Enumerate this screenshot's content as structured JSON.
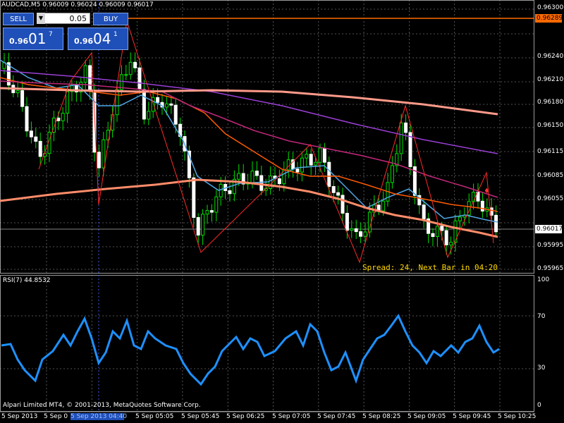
{
  "header": {
    "title": "AUDCAD,M5",
    "ohlc": "0.96009 0.96024 0.96009 0.96017"
  },
  "trade_panel": {
    "sell_label": "SELL",
    "buy_label": "BUY",
    "lot_value": "0.05",
    "sell_small": "0.96",
    "sell_big": "01",
    "sell_sup": "7",
    "buy_small": "0.96",
    "buy_big": "04",
    "buy_sup": "1"
  },
  "price_axis": {
    "labels": [
      "0.96300",
      "0.96240",
      "0.96210",
      "0.96180",
      "0.96150",
      "0.96115",
      "0.96085",
      "0.96055",
      "0.95995",
      "0.95965"
    ],
    "hline_tag": "0.96289",
    "bid_tag": "0.96017",
    "hline_color": "#ff6a00"
  },
  "status": {
    "spread_text": "Spread: 24, Next Bar in 04:20",
    "spread_color": "#ffd700"
  },
  "rsi": {
    "label": "RSI(7) 44.8532",
    "levels": [
      "100",
      "70",
      "30",
      "0"
    ],
    "color": "#1e90ff"
  },
  "footer": {
    "copyright": "Alpari Limited MT4, © 2001-2013, MetaQuotes Software Corp."
  },
  "time_axis": {
    "labels": [
      "5 Sep 2013",
      "5 Sep 0",
      "5 Sep 05:05",
      "5 Sep 05:45",
      "5 Sep 06:25",
      "5 Sep 07:05",
      "5 Sep 07:45",
      "5 Sep 08:25",
      "5 Sep 09:05",
      "5 Sep 09:45",
      "5 Sep 10:25"
    ],
    "highlight": "5 Sep 2013 04:40"
  },
  "colors": {
    "bull": "#00e000",
    "bear": "#ffffff",
    "zigzag": "#ff2a2a",
    "ma_fast": "#4fa8e8",
    "ma_orange": "#ff5a00",
    "ma_salmon": "#ff8c6a",
    "ma_magenta": "#c0287a",
    "ma_purple": "#9b3fd6",
    "ma_light_salmon": "#ff9a8a",
    "grid": "#6a6a6a"
  }
}
